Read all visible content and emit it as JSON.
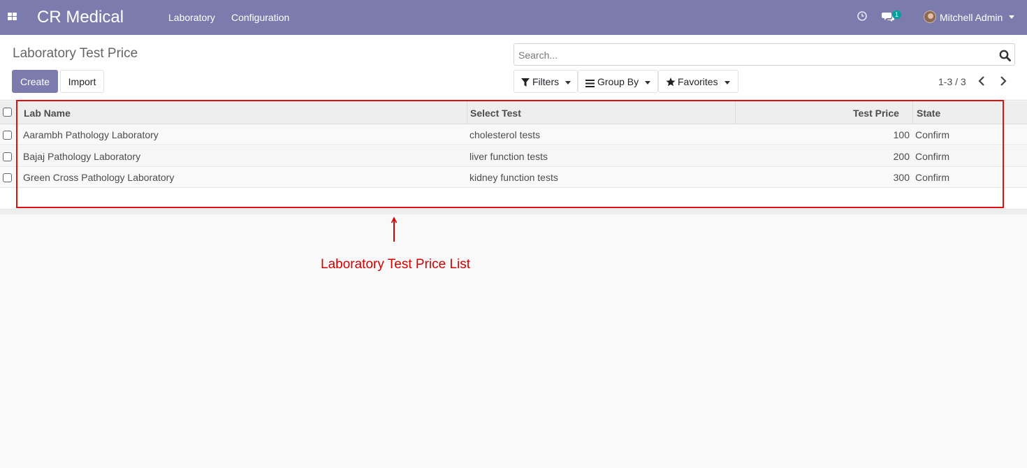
{
  "navbar": {
    "app_name": "CR Medical",
    "menus": [
      "Laboratory",
      "Configuration"
    ],
    "messages_count": "1",
    "user_name": "Mitchell Admin"
  },
  "control_panel": {
    "breadcrumb": "Laboratory Test Price",
    "create_label": "Create",
    "import_label": "Import",
    "search_placeholder": "Search...",
    "filters_label": "Filters",
    "groupby_label": "Group By",
    "favorites_label": "Favorites",
    "pager_value": "1-3 / 3"
  },
  "table": {
    "columns": [
      "Lab Name",
      "Select Test",
      "Test Price",
      "State"
    ],
    "rows": [
      {
        "lab_name": "Aarambh Pathology Laboratory",
        "test": "cholesterol tests",
        "price": "100",
        "state": "Confirm"
      },
      {
        "lab_name": "Bajaj Pathology Laboratory",
        "test": "liver function tests",
        "price": "200",
        "state": "Confirm"
      },
      {
        "lab_name": "Green Cross Pathology Laboratory",
        "test": "kidney function tests",
        "price": "300",
        "state": "Confirm"
      }
    ]
  },
  "annotation": {
    "label": "Laboratory Test Price List"
  },
  "colors": {
    "brand": "#7c7bad",
    "annotation": "#e01010",
    "badge": "#00a09d"
  }
}
